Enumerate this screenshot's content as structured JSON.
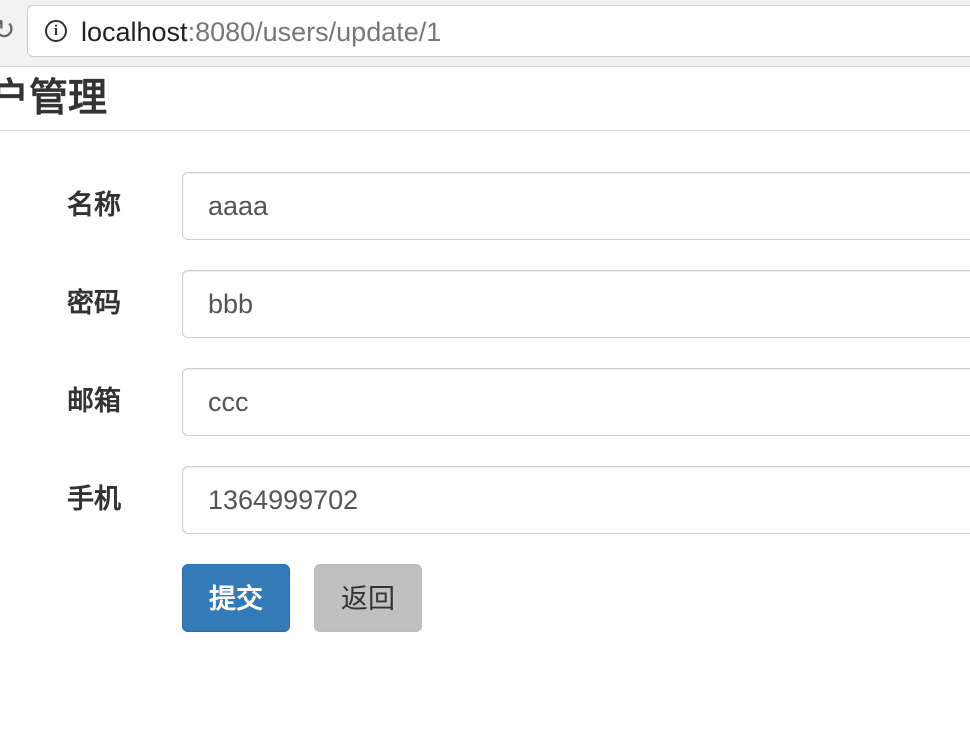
{
  "browser": {
    "url_host": "localhost",
    "url_path": ":8080/users/update/1"
  },
  "header": {
    "title": "户管理"
  },
  "form": {
    "fields": [
      {
        "label": "名称",
        "value": "aaaa"
      },
      {
        "label": "密码",
        "value": "bbb"
      },
      {
        "label": "邮箱",
        "value": "ccc"
      },
      {
        "label": "手机",
        "value": "1364999702"
      }
    ],
    "submit_label": "提交",
    "back_label": "返回"
  }
}
